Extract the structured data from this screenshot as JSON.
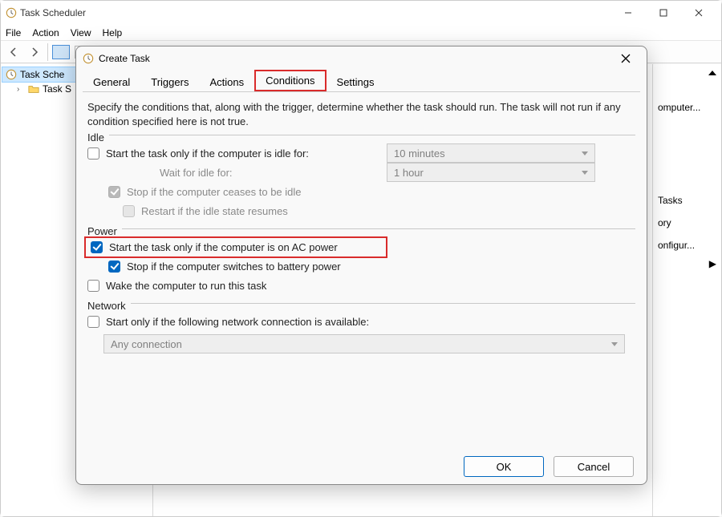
{
  "window": {
    "title": "Task Scheduler"
  },
  "menubar": {
    "file": "File",
    "action": "Action",
    "view": "View",
    "help": "Help"
  },
  "tree": {
    "root": "Task Sche",
    "child": "Task S"
  },
  "actions_panel": {
    "items": [
      "omputer...",
      "",
      "Tasks",
      "ory",
      "onfigur..."
    ]
  },
  "dialog": {
    "title": "Create Task",
    "tabs": {
      "general": "General",
      "triggers": "Triggers",
      "actions": "Actions",
      "conditions": "Conditions",
      "settings": "Settings"
    },
    "desc": "Specify the conditions that, along with the trigger, determine whether the task should run.  The task will not run  if any condition specified here is not true.",
    "idle": {
      "label": "Idle",
      "start_only_idle": "Start the task only if the computer is idle for:",
      "wait_for_idle": "Wait for idle for:",
      "stop_cease": "Stop if the computer ceases to be idle",
      "restart_idle": "Restart if the idle state resumes",
      "idle_duration": "10 minutes",
      "idle_wait": "1 hour"
    },
    "power": {
      "label": "Power",
      "ac_power": "Start the task only if the computer is on AC power",
      "stop_battery": "Stop if the computer switches to battery power",
      "wake": "Wake the computer to run this task"
    },
    "network": {
      "label": "Network",
      "start_only": "Start only if the following network connection is available:",
      "any_connection": "Any connection"
    },
    "buttons": {
      "ok": "OK",
      "cancel": "Cancel"
    }
  }
}
